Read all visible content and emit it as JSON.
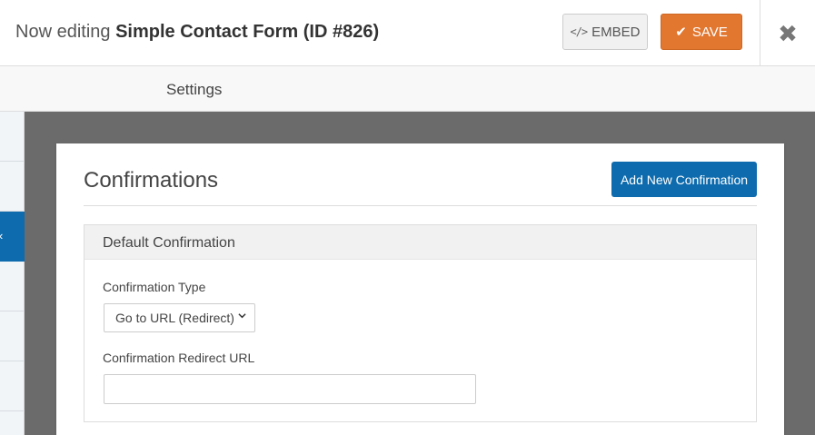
{
  "header": {
    "title_prefix": "Now editing",
    "form_name": "Simple Contact Form (ID #826)",
    "embed_icon": "</>",
    "embed_label": "EMBED",
    "save_icon": "✔",
    "save_label": "SAVE",
    "close_icon": "✖"
  },
  "tabbar": {
    "active_tab": "Settings"
  },
  "sidebar": {
    "active_chevron": "‹"
  },
  "panel": {
    "heading": "Confirmations",
    "add_button": "Add New Confirmation",
    "confirmation": {
      "title": "Default Confirmation",
      "type_label": "Confirmation Type",
      "type_value": "Go to URL (Redirect)",
      "url_label": "Confirmation Redirect URL",
      "url_value": ""
    }
  },
  "colors": {
    "save": "#e27730",
    "primary": "#0e6bad",
    "canvas": "#6b6b6b"
  }
}
